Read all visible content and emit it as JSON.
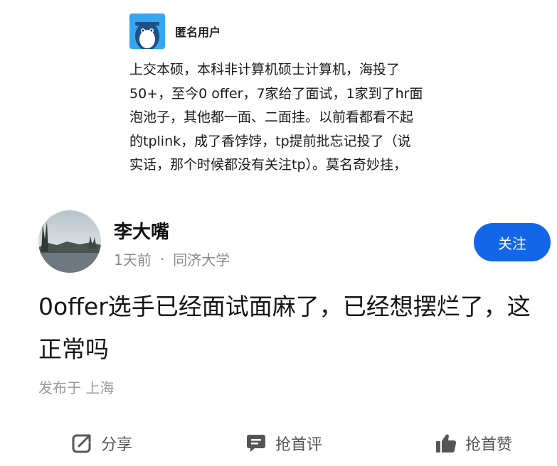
{
  "quoted": {
    "username": "匿名用户",
    "body": "上交本硕，本科非计算机硕士计算机，海投了\n50+，至今0 offer，7家给了面试，1家到了hr面\n泡池子，其他都一面、二面挂。以前看都看不起\n的tplink，成了香饽饽，tp提前批忘记投了（说\n实话，那个时候都没有关注tp）。莫名奇妙挂，"
  },
  "post": {
    "author": "李大嘴",
    "time": "1天前",
    "separator": "·",
    "school": "同济大学",
    "follow_label": "关注",
    "title": "0offer选手已经面试面麻了，已经想摆烂了，这正常吗",
    "location": "发布于 上海"
  },
  "actions": {
    "share": "分享",
    "comment": "抢首评",
    "like": "抢首赞"
  },
  "colors": {
    "accent": "#1466e8",
    "muted": "#8a8a8a"
  }
}
